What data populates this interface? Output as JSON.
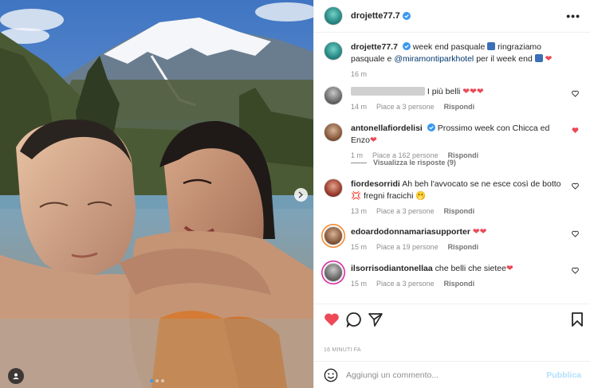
{
  "post": {
    "author": "drojette77.7",
    "more_label": "•••",
    "caption": {
      "username": "drojette77.7",
      "text_1": "week end pasquale",
      "text_2": "ringraziamo pasquale e",
      "mention": "@miramontiparkhotel",
      "text_3": "per il week end",
      "time": "16 m"
    },
    "comments": [
      {
        "username": "",
        "text": "I più belli",
        "emoji": "❤❤❤",
        "time": "14 m",
        "likes": "Piace a 3 persone",
        "reply": "Rispondi",
        "liked": false
      },
      {
        "username": "antonellafiordelisi",
        "text": "Prossimo week con Chicca ed Enzo",
        "emoji": "❤",
        "time": "1 m",
        "likes": "Piace a 162 persone",
        "reply": "Rispondi",
        "liked": true
      },
      {
        "username": "fiordesorridi",
        "text": "Ah beh l'avvocato se ne esce così de botto 💢 fregni fracichi 🫢",
        "emoji": "",
        "time": "13 m",
        "likes": "Piace a 3 persone",
        "reply": "Rispondi",
        "liked": false
      },
      {
        "username": "edoardodonnamariasupporter",
        "text": "",
        "emoji": "❤❤",
        "time": "15 m",
        "likes": "Piace a 19 persone",
        "reply": "Rispondi",
        "liked": false
      },
      {
        "username": "ilsorrisodiantonellaa",
        "text": "che belli che sietee",
        "emoji": "❤",
        "time": "15 m",
        "likes": "Piace a 3 persone",
        "reply": "Rispondi",
        "liked": false
      }
    ],
    "view_replies": "Visualizza le risposte (9)",
    "time_ago": "16 MINUTI FA",
    "composer": {
      "placeholder": "Aggiungi un commento...",
      "publish": "Pubblica"
    }
  },
  "colors": {
    "accent_blue": "#0095f6",
    "like_red": "#ed4956",
    "verified_blue": "#3897f0"
  },
  "icons": [
    "heart-icon",
    "comment-icon",
    "share-icon",
    "bookmark-icon",
    "emoji-icon",
    "verified-icon",
    "next-arrow-icon",
    "tag-user-icon",
    "more-icon"
  ]
}
